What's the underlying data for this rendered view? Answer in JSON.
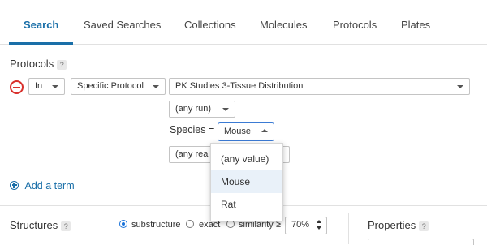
{
  "tabs": [
    {
      "label": "Search",
      "active": true
    },
    {
      "label": "Saved Searches"
    },
    {
      "label": "Collections"
    },
    {
      "label": "Molecules"
    },
    {
      "label": "Protocols"
    },
    {
      "label": "Plates"
    }
  ],
  "protocols": {
    "label": "Protocols",
    "help": "?",
    "operator": "In",
    "type_select": "Specific Protocol",
    "protocol_select": "PK Studies 3-Tissue Distribution",
    "run_select": "(any run)",
    "species_label": "Species =",
    "species_select": "Mouse",
    "readout_select_partial": "(any rea",
    "species_options": [
      "(any value)",
      "Mouse",
      "Rat"
    ],
    "highlighted_option": "Mouse"
  },
  "add_term": "Add a term",
  "structures": {
    "label": "Structures",
    "help": "?",
    "options": [
      {
        "label": "substructure",
        "selected": true
      },
      {
        "label": "exact",
        "selected": false
      },
      {
        "label": "similarity ≥",
        "selected": false
      }
    ],
    "similarity_value": "70%"
  },
  "properties": {
    "label": "Properties",
    "help": "?"
  },
  "colors": {
    "accent": "#1a6fa8",
    "remove": "#d9302c",
    "menu_highlight": "#e9f1f9"
  }
}
